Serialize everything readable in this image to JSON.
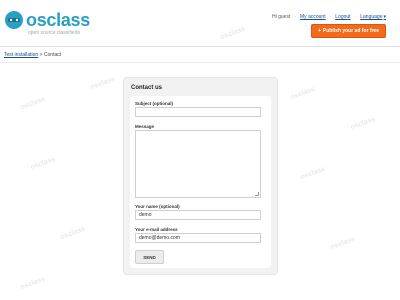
{
  "header": {
    "logo": {
      "name": "osclass",
      "tagline": "open source classifieds"
    },
    "greeting": "Hi guest",
    "links": {
      "my_account": "My account",
      "logout": "Logout",
      "language": "Language"
    },
    "publish_button": "Publish your ad for free"
  },
  "breadcrumb": {
    "home": "Test installation",
    "separator": ">",
    "current": "Contact"
  },
  "contact_form": {
    "title": "Contact us",
    "subject_label": "Subject (optional)",
    "subject_value": "",
    "message_label": "Message",
    "message_value": "",
    "name_label": "Your name (optional)",
    "name_value": "demo",
    "email_label": "Your e-mail address",
    "email_value": "demo@demo.com",
    "send_button": "SEND"
  },
  "watermark_text": "osclass",
  "colors": {
    "brand": "#2a9fc4",
    "publish": "#f26b1d",
    "link": "#1a4e8a"
  },
  "icons": {
    "logo": "osclass-logo-icon",
    "caret": "caret-down-icon",
    "plus": "plus-icon"
  }
}
